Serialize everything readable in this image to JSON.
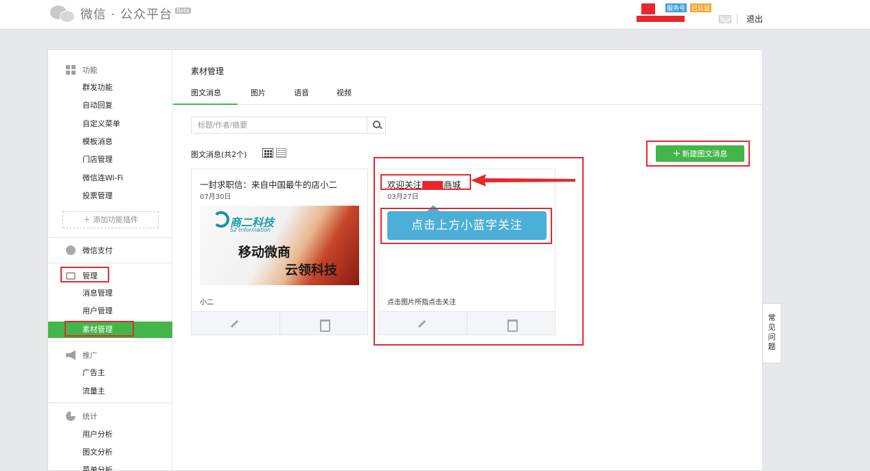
{
  "header": {
    "app_title": "微信 · 公众平台",
    "beta": "Beta",
    "badge_service": "服务号",
    "badge_verified": "已认证",
    "logout": "退出"
  },
  "sidebar": {
    "sections": [
      {
        "title": "功能",
        "icon": "grid-icon",
        "items": [
          "群发功能",
          "自动回复",
          "自定义菜单",
          "模板消息",
          "门店管理",
          "微信连Wi-Fi",
          "投票管理"
        ]
      },
      {
        "title": "微信支付",
        "icon": "payment-icon",
        "items": []
      },
      {
        "title": "管理",
        "icon": "inbox-icon",
        "items": [
          "消息管理",
          "用户管理",
          "素材管理"
        ]
      },
      {
        "title": "推广",
        "icon": "megaphone-icon",
        "items": [
          "广告主",
          "流量主"
        ]
      },
      {
        "title": "统计",
        "icon": "pie-chart-icon",
        "items": [
          "用户分析",
          "图文分析",
          "菜单分析"
        ]
      }
    ],
    "add_plugin": "添加功能插件",
    "active_item": "素材管理"
  },
  "content": {
    "page_title": "素材管理",
    "tabs": [
      "图文消息",
      "图片",
      "语音",
      "视频"
    ],
    "active_tab": "图文消息",
    "search_placeholder": "标题/作者/摘要",
    "list_header": "图文消息(共2个)",
    "new_button": "新建图文消息",
    "cards": [
      {
        "title": "一封求职信：来自中国最牛的店小二",
        "date": "07月30日",
        "image_texts": {
          "brand": "商二科技",
          "brand_en": "S2 Information",
          "line1": "移动微商",
          "line2": "云领科技"
        },
        "footer": "小二"
      },
      {
        "title_prefix": "欢迎关注",
        "title_suffix": "商城",
        "date": "03月27日",
        "banner": "点击上方小蓝字关注",
        "footer": "点击图片所指点击关注"
      }
    ]
  },
  "faq": [
    "常",
    "见",
    "问",
    "题"
  ],
  "colors": {
    "accent_green": "#44b549",
    "annotation_red": "#e8262b",
    "banner_blue": "#4bafd8"
  }
}
